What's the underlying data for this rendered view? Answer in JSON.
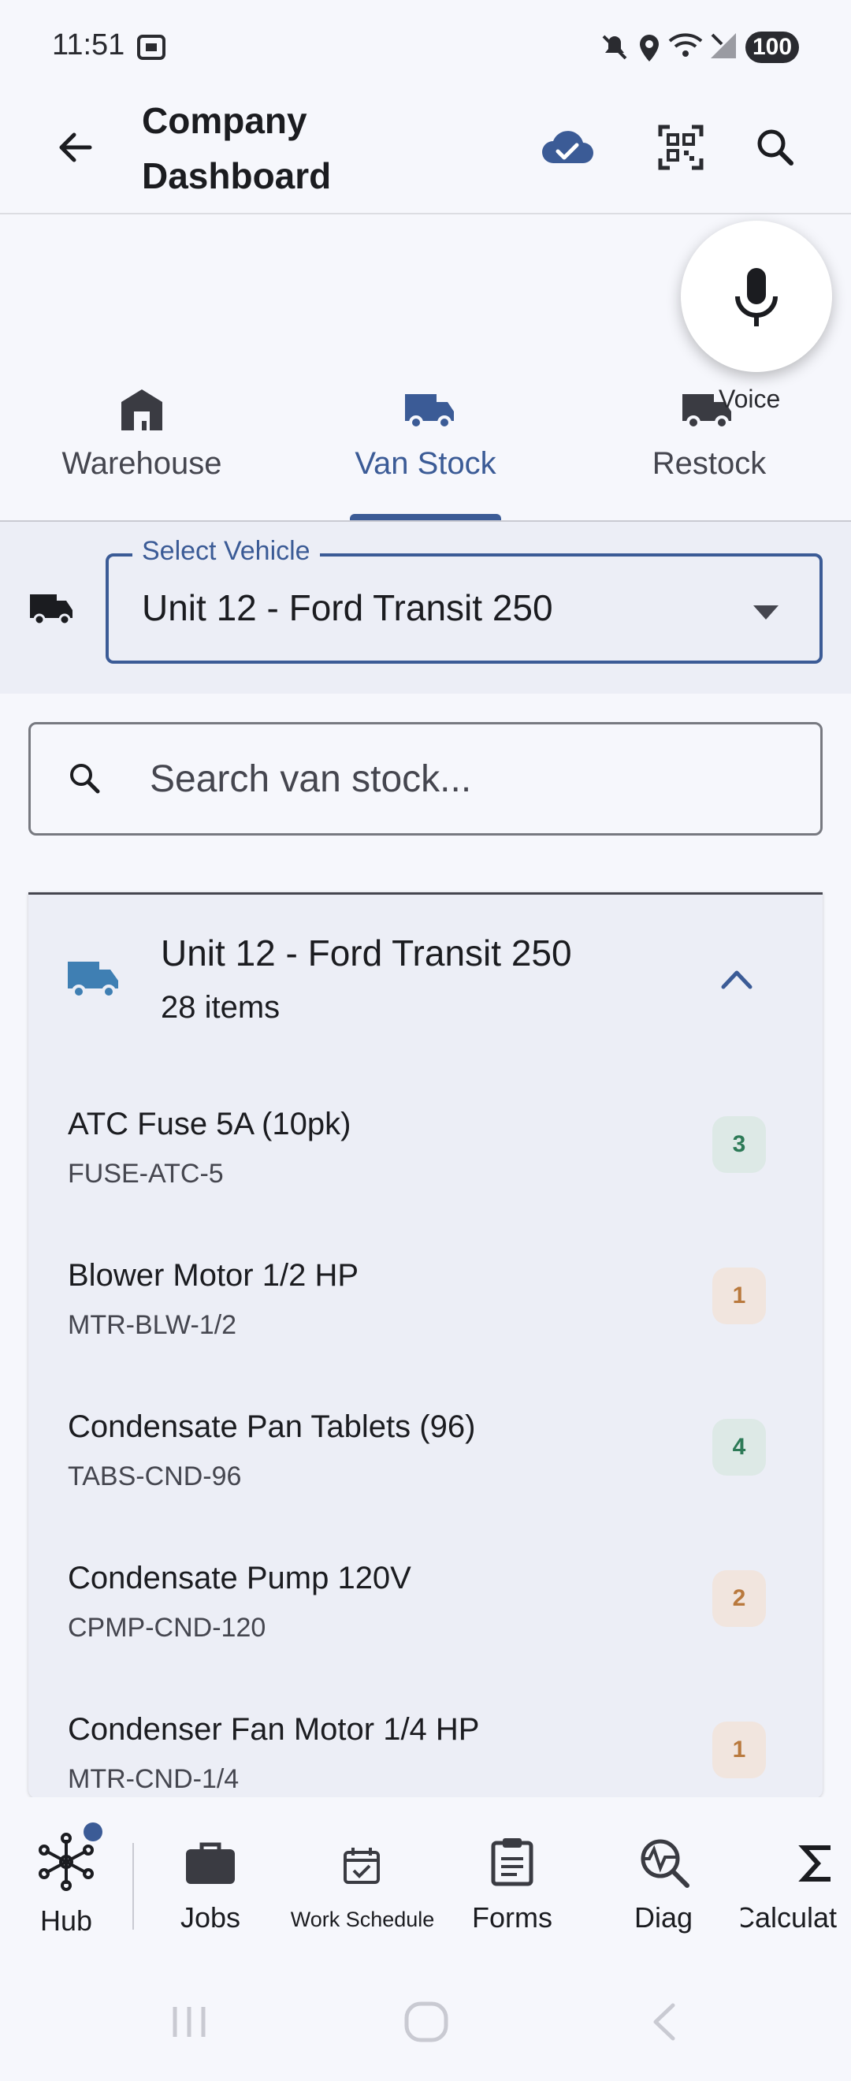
{
  "status_bar": {
    "time": "11:51",
    "battery": "100"
  },
  "app_bar": {
    "title": "Company Dashboard"
  },
  "voice": {
    "label": "Voice"
  },
  "tabs": [
    {
      "label": "Warehouse",
      "icon": "warehouse-icon",
      "selected": false
    },
    {
      "label": "Van Stock",
      "icon": "van-icon",
      "selected": true
    },
    {
      "label": "Restock",
      "icon": "truck-icon",
      "selected": false
    }
  ],
  "vehicle_select": {
    "label": "Select Vehicle",
    "value": "Unit 12 - Ford Transit 250"
  },
  "search": {
    "placeholder": "Search van stock..."
  },
  "van_card": {
    "title": "Unit 12 - Ford Transit 250",
    "subtitle": "28 items",
    "items": [
      {
        "name": "ATC Fuse 5A (10pk)",
        "sku": "FUSE-ATC-5",
        "qty": "3",
        "level": "ok"
      },
      {
        "name": "Blower Motor 1/2 HP",
        "sku": "MTR-BLW-1/2",
        "qty": "1",
        "level": "low"
      },
      {
        "name": "Condensate Pan Tablets (96)",
        "sku": "TABS-CND-96",
        "qty": "4",
        "level": "ok"
      },
      {
        "name": "Condensate Pump 120V",
        "sku": "CPMP-CND-120",
        "qty": "2",
        "level": "low"
      },
      {
        "name": "Condenser Fan Motor 1/4 HP",
        "sku": "MTR-CND-1/4",
        "qty": "1",
        "level": "low"
      }
    ]
  },
  "bottom_nav": [
    {
      "label": "Hub",
      "icon": "hub-icon"
    },
    {
      "label": "Jobs",
      "icon": "briefcase-icon"
    },
    {
      "label": "Work Schedule",
      "icon": "calendar-check-icon"
    },
    {
      "label": "Forms",
      "icon": "clipboard-icon"
    },
    {
      "label": "Diag",
      "icon": "diagnostics-icon"
    },
    {
      "label": "Calculat",
      "icon": "sigma-icon"
    }
  ],
  "colors": {
    "accent": "#3b5b96",
    "qty_ok_bg": "#dde9e6",
    "qty_ok_text": "#2d7a57",
    "qty_low_bg": "#f1e5de",
    "qty_low_text": "#b9793d"
  }
}
